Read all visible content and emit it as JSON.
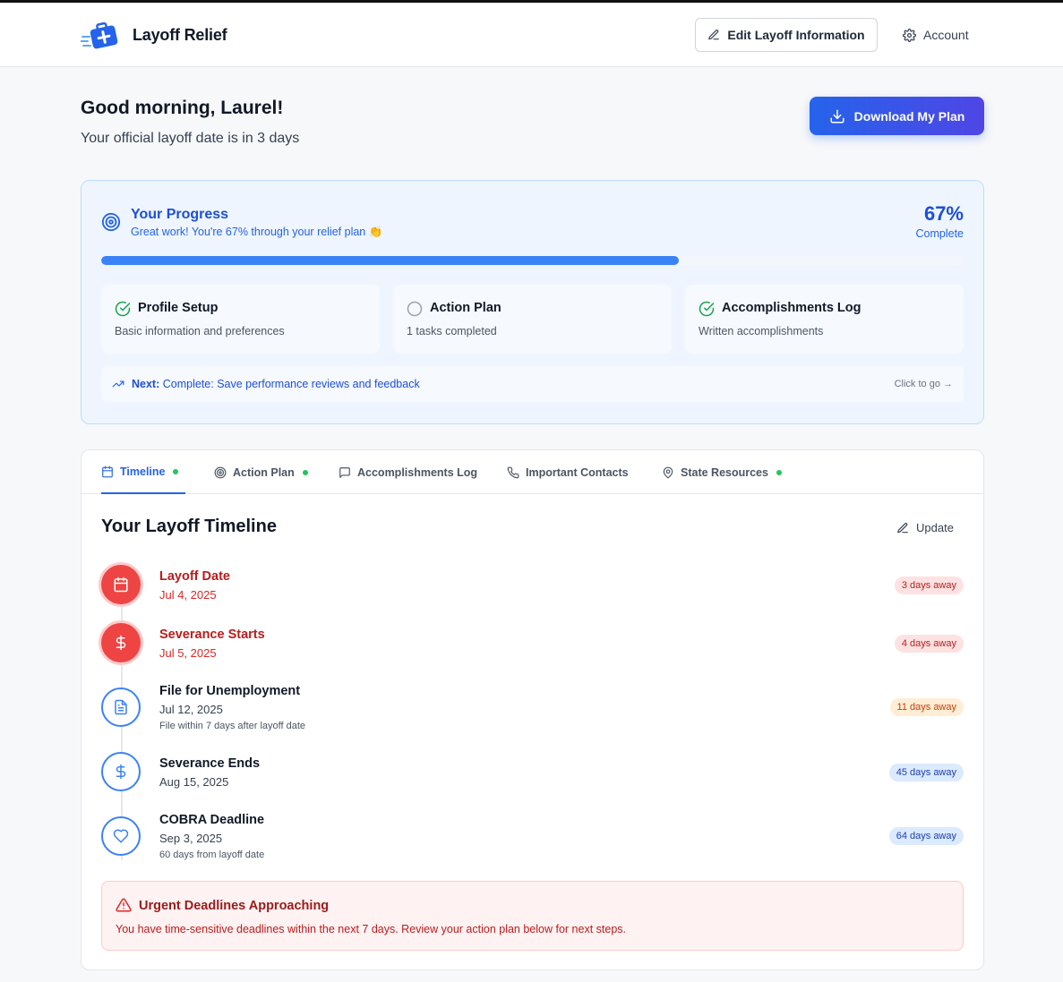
{
  "header": {
    "brand": "Layoff Relief",
    "edit_label": "Edit Layoff Information",
    "account_label": "Account"
  },
  "greeting": {
    "title": "Good morning, Laurel!",
    "subtitle": "Your official layoff date is in 3 days",
    "download_label": "Download My Plan"
  },
  "progress": {
    "title": "Your Progress",
    "subtitle": "Great work! You're 67% through your relief plan 👏",
    "percent_text": "67%",
    "percent_value": 0.67,
    "complete_label": "Complete",
    "steps": [
      {
        "title": "Profile Setup",
        "desc": "Basic information and preferences",
        "status": "done"
      },
      {
        "title": "Action Plan",
        "desc": "1 tasks completed",
        "status": "pending"
      },
      {
        "title": "Accomplishments Log",
        "desc": "Written accomplishments",
        "status": "done"
      }
    ],
    "next_prefix": "Next:",
    "next_text": "Complete: Save performance reviews and feedback",
    "next_go": "Click to go →"
  },
  "tabs": [
    {
      "label": "Timeline",
      "icon": "calendar-icon",
      "dot": true,
      "active": true
    },
    {
      "label": "Action Plan",
      "icon": "target-icon",
      "dot": true,
      "active": false
    },
    {
      "label": "Accomplishments Log",
      "icon": "message-icon",
      "dot": false,
      "active": false
    },
    {
      "label": "Important Contacts",
      "icon": "phone-icon",
      "dot": false,
      "active": false
    },
    {
      "label": "State Resources",
      "icon": "map-pin-icon",
      "dot": true,
      "active": false
    }
  ],
  "timeline": {
    "title": "Your Layoff Timeline",
    "update_label": "Update",
    "items": [
      {
        "name": "Layoff Date",
        "date": "Jul 4, 2025",
        "note": "",
        "badge": "3 days away",
        "tone": "red",
        "icon": "calendar-icon"
      },
      {
        "name": "Severance Starts",
        "date": "Jul 5, 2025",
        "note": "",
        "badge": "4 days away",
        "tone": "red",
        "icon": "dollar-icon"
      },
      {
        "name": "File for Unemployment",
        "date": "Jul 12, 2025",
        "note": "File within 7 days after layoff date",
        "badge": "11 days away",
        "tone": "orange",
        "icon": "document-icon"
      },
      {
        "name": "Severance Ends",
        "date": "Aug 15, 2025",
        "note": "",
        "badge": "45 days away",
        "tone": "blue",
        "icon": "dollar-icon"
      },
      {
        "name": "COBRA Deadline",
        "date": "Sep 3, 2025",
        "note": "60 days from layoff date",
        "badge": "64 days away",
        "tone": "blue",
        "icon": "heart-icon"
      }
    ]
  },
  "alert": {
    "title": "Urgent Deadlines Approaching",
    "text": "You have time-sensitive deadlines within the next 7 days. Review your action plan below for next steps."
  },
  "colors": {
    "primary": "#2563eb",
    "danger": "#ef4444",
    "success": "#16a34a",
    "warning": "#c2410c"
  }
}
